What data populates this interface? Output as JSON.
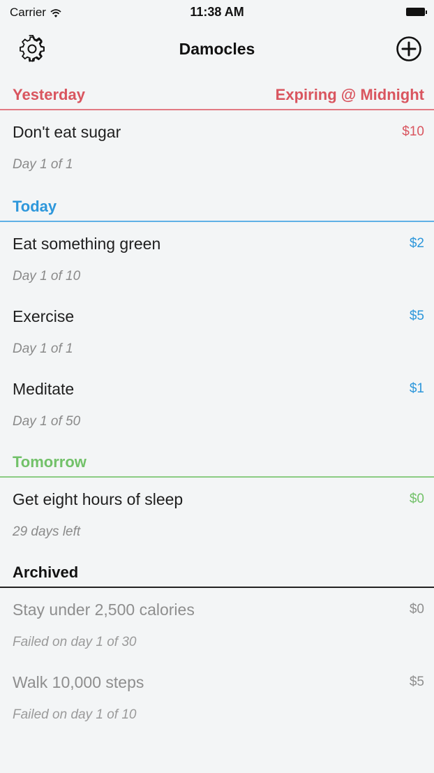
{
  "status_bar": {
    "carrier": "Carrier",
    "time": "11:38 AM"
  },
  "nav": {
    "title": "Damocles",
    "left_icon": "gear-icon",
    "right_icon": "plus-circle-icon"
  },
  "colors": {
    "red": "#d9555f",
    "blue": "#2d97db",
    "green": "#72c169",
    "archived_gray": "#8e8e8e"
  },
  "sections": {
    "yesterday": {
      "title": "Yesterday",
      "note": "Expiring @ Midnight",
      "items": [
        {
          "title": "Don't eat sugar",
          "subtitle": "Day 1 of 1",
          "amount": "$10"
        }
      ]
    },
    "today": {
      "title": "Today",
      "items": [
        {
          "title": "Eat something green",
          "subtitle": "Day 1 of 10",
          "amount": "$2"
        },
        {
          "title": "Exercise",
          "subtitle": "Day 1 of 1",
          "amount": "$5"
        },
        {
          "title": "Meditate",
          "subtitle": "Day 1 of 50",
          "amount": "$1"
        }
      ]
    },
    "tomorrow": {
      "title": "Tomorrow",
      "items": [
        {
          "title": "Get eight hours of sleep",
          "subtitle": "29 days left",
          "amount": "$0"
        }
      ]
    },
    "archived": {
      "title": "Archived",
      "items": [
        {
          "title": "Stay under 2,500 calories",
          "subtitle": "Failed on day 1 of 30",
          "amount": "$0"
        },
        {
          "title": "Walk 10,000 steps",
          "subtitle": "Failed on day 1 of 10",
          "amount": "$5"
        }
      ]
    }
  }
}
